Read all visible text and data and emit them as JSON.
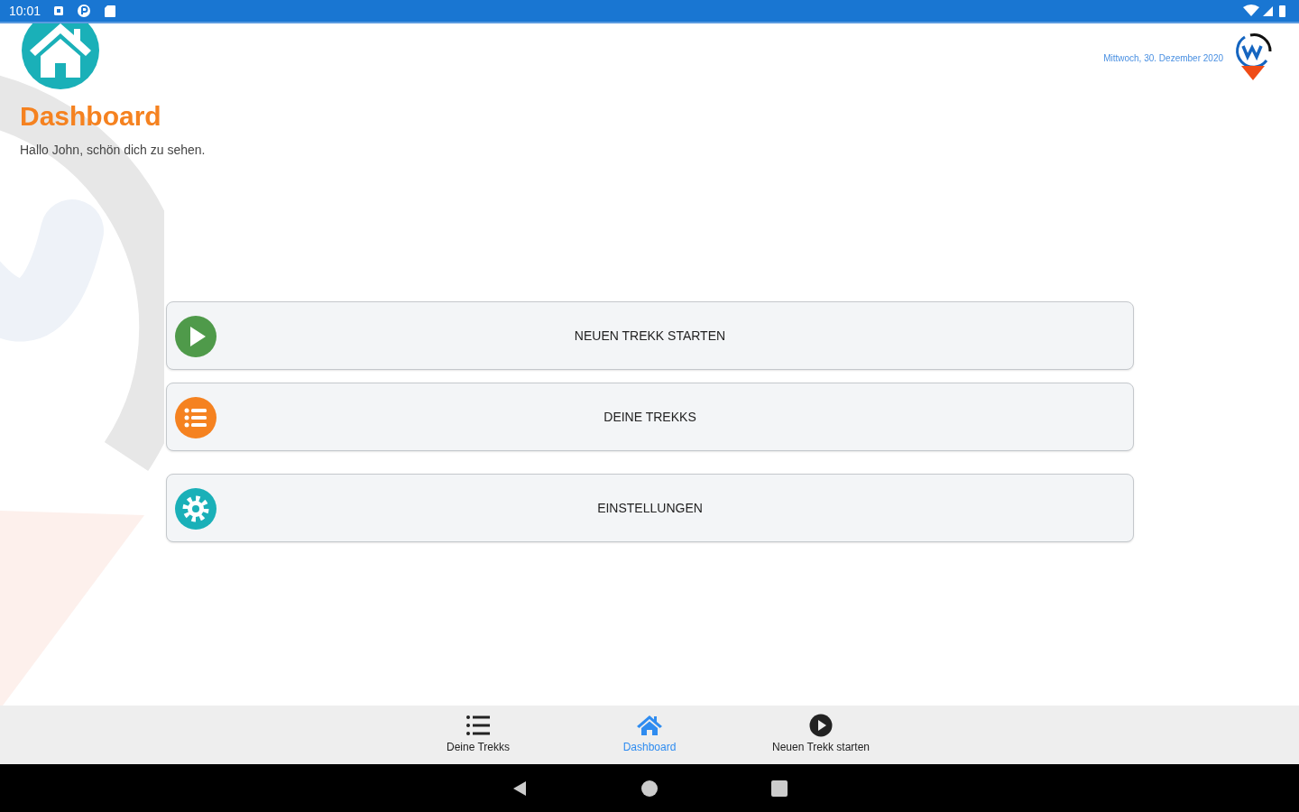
{
  "status_bar": {
    "time": "10:01"
  },
  "header": {
    "title": "Dashboard",
    "greeting": "Hallo John, schön dich zu sehen.",
    "date": "Mittwoch, 30. Dezember 2020"
  },
  "actions": [
    {
      "label": "NEUEN TREKK STARTEN",
      "kind": "play",
      "color": "#4f9a4a"
    },
    {
      "label": "DEINE TREKKS",
      "kind": "list",
      "color": "#f58220"
    },
    {
      "label": "EINSTELLUNGEN",
      "kind": "gear",
      "color": "#1ab0b8"
    }
  ],
  "bottom_nav": [
    {
      "label": "Deine Trekks",
      "kind": "list",
      "selected": false
    },
    {
      "label": "Dashboard",
      "kind": "home",
      "selected": true
    },
    {
      "label": "Neuen Trekk starten",
      "kind": "play",
      "selected": false
    }
  ]
}
